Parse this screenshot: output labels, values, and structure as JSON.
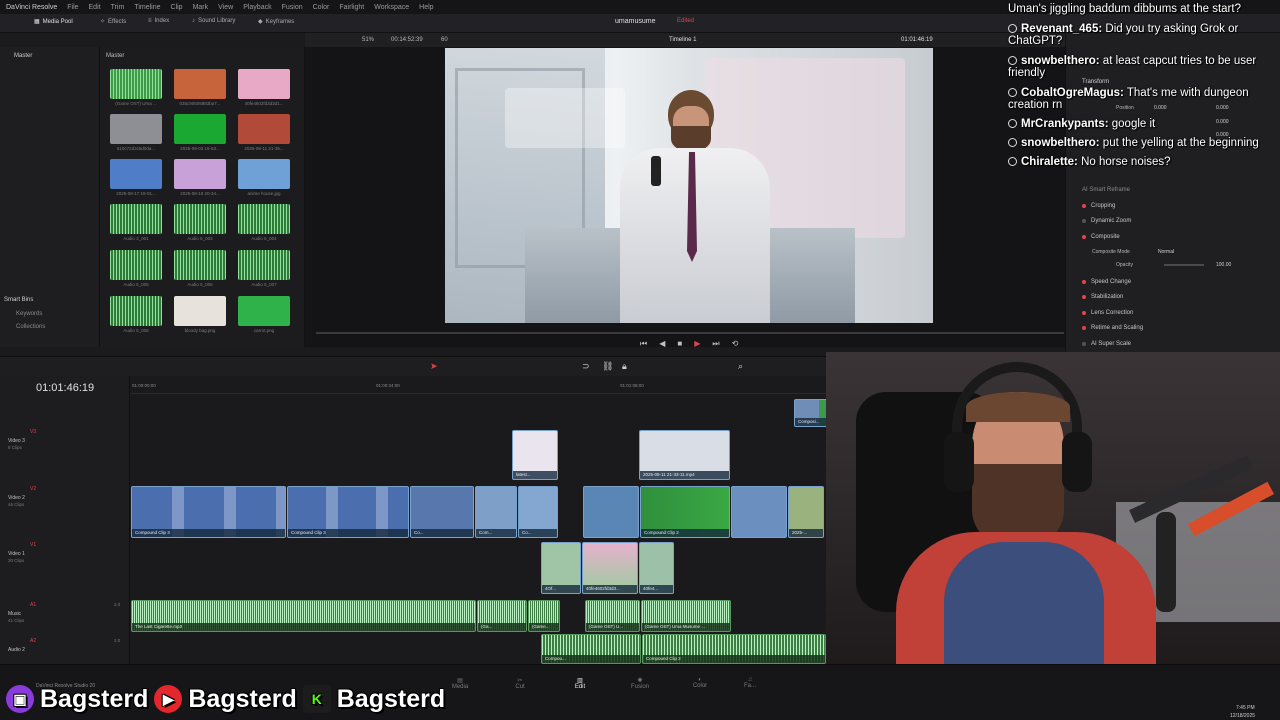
{
  "app": {
    "name": "DaVinci Resolve",
    "menus": [
      "File",
      "Edit",
      "Trim",
      "Timeline",
      "Clip",
      "Mark",
      "View",
      "Playback",
      "Fusion",
      "Color",
      "Fairlight",
      "Workspace",
      "Help"
    ]
  },
  "toolbar": {
    "media_pool": "Media Pool",
    "effects": "Effects",
    "index": "Index",
    "sound_library": "Sound Library",
    "keyframes": "Keyframes",
    "project_name": "umamusume",
    "project_status": "Edited",
    "inspector": "Inspector"
  },
  "bins": {
    "master": "Master",
    "smart_bins": "Smart Bins",
    "keywords": "Keywords",
    "collections": "Collections"
  },
  "media_pool": {
    "title": "Master",
    "items": [
      {
        "label": "(Game OST) Uma ...",
        "color": "#3f9a48"
      },
      {
        "label": "035c90505883ba7...",
        "color": "#c8643c"
      },
      {
        "label": "40fe4602fd3d3d1...",
        "color": "#e7a9c6"
      },
      {
        "label": "610c72d3c5d0da...",
        "color": "#8d8f94"
      },
      {
        "label": "2025-08-03 16-53...",
        "color": "#1aa832"
      },
      {
        "label": "2025-08-11 21-35...",
        "color": "#b24a3a"
      },
      {
        "label": "2025-08-17 18-01...",
        "color": "#4f7dc7"
      },
      {
        "label": "2025-08-18 20-34...",
        "color": "#c9a1d9"
      },
      {
        "label": "anime house.jpg",
        "color": "#6fa0d6"
      },
      {
        "label": "Audio 3_001",
        "color": "#2f7a3a"
      },
      {
        "label": "Audio 5_003",
        "color": "#2f7a3a"
      },
      {
        "label": "Audio 5_004",
        "color": "#2f7a3a"
      },
      {
        "label": "Audio 5_005",
        "color": "#2f7a3a"
      },
      {
        "label": "Audio 5_006",
        "color": "#2f7a3a"
      },
      {
        "label": "Audio 5_007",
        "color": "#2f7a3a"
      },
      {
        "label": "Audio 5_008",
        "color": "#2f7a3a"
      },
      {
        "label": "bloody bag.png",
        "color": "#e8e2dc"
      },
      {
        "label": "carrot.png",
        "color": "#2fb24a"
      }
    ]
  },
  "viewer": {
    "zoom": "51%",
    "source_tc": "00:14:52:39",
    "fps": "60",
    "timeline_name": "Timeline 1",
    "timecode": "01:01:46:19"
  },
  "inspector": {
    "sections": [
      "Video"
    ],
    "transform": "Transform",
    "position_label": "Position",
    "position_x": "0.000",
    "position_y": "0.000",
    "anchor_label": "Anchor Point",
    "anchor_x": "0.000",
    "anchor_y": "0.000",
    "ai_reframe": "AI Smart Reframe",
    "cropping": "Cropping",
    "dynamic_zoom": "Dynamic Zoom",
    "composite": "Composite",
    "composite_mode_label": "Composite Mode",
    "composite_mode": "Normal",
    "opacity_label": "Opacity",
    "opacity": "100.00",
    "speed_change": "Speed Change",
    "stabilization": "Stabilization",
    "lens_correction": "Lens Correction",
    "retime": "Retime and Scaling",
    "ai_super_scale": "AI Super Scale"
  },
  "chat": [
    {
      "user": "",
      "text": "Uman's jiggling baddum dibbums at the start?"
    },
    {
      "user": "Revenant_465:",
      "text": "Did you try asking Grok or ChatGPT?"
    },
    {
      "user": "snowbelthero:",
      "text": "at least capcut tries to be user friendly"
    },
    {
      "user": "CobaltOgreMagus:",
      "text": "That's me with dungeon creation rn"
    },
    {
      "user": "MrCrankypants:",
      "text": "google it"
    },
    {
      "user": "snowbelthero:",
      "text": "put the yelling at the beginning"
    },
    {
      "user": "Chiralette:",
      "text": "No horse noises?"
    }
  ],
  "timeline": {
    "timecode": "01:01:46:19",
    "ruler": [
      "01:00:00:00",
      "01:00:34:00",
      "01:01:08:00",
      "01:01:42:00",
      "01:02:16:00"
    ],
    "tracks": [
      {
        "id": "V3",
        "name": "Video 3",
        "clips": "8 Clips"
      },
      {
        "id": "V2",
        "name": "Video 2",
        "clips": "46 Clips"
      },
      {
        "id": "V1",
        "name": "Video 1",
        "clips": "30 Clips"
      },
      {
        "id": "A1",
        "name": "Music",
        "clips": "41 Clips",
        "level": "2.0"
      },
      {
        "id": "A2",
        "name": "Audio 2",
        "clips": "",
        "level": "2.0"
      }
    ],
    "clip_labels": {
      "compound1": "Compound Clip 3",
      "compound2": "Compound Clip 3",
      "compound3": "Compound Clip 2",
      "compound4": "Compound Clip 2",
      "v3a": "latest...",
      "v3b": "2025-08-11 21-33-11.mp4",
      "v1a": "40fe4602fd3d3...",
      "v1b": "40fe4...",
      "v1c": "4Of...",
      "music1": "The Last Cigarette.mp3",
      "music2": "(Ga...",
      "music3": "(Game...",
      "music4": "(Game OST) U...",
      "music5": "(Game OST) Uma Musume ...",
      "a2a": "Compou...",
      "top_comp": "Composi...",
      "co": "Co...",
      "com": "Com...",
      "v2small": "Co...",
      "date": "2025-..."
    }
  },
  "pages": [
    "Media",
    "Cut",
    "Edit",
    "Fusion",
    "Color",
    "Fa..."
  ],
  "studio": "DaVinci Resolve Studio 20",
  "banner": {
    "name1": "Bagsterd",
    "name2": "Bagsterd",
    "name3": "Bagsterd"
  },
  "clock": {
    "time": "7:45 PM",
    "date": "12/18/2025"
  }
}
